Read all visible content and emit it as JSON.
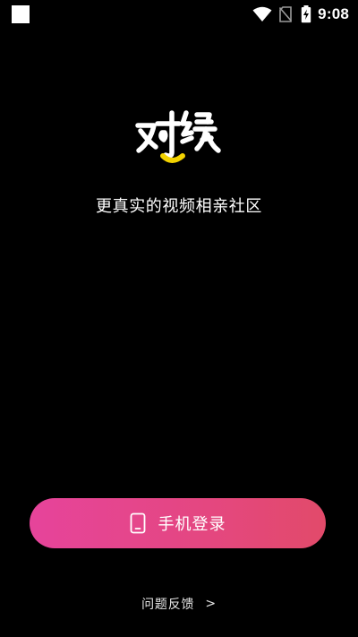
{
  "status_bar": {
    "time": "9:08",
    "icons": [
      "notification-square-icon",
      "wifi-icon",
      "no-sim-icon",
      "battery-charging-icon"
    ]
  },
  "app": {
    "logo_text": "对缘",
    "tagline": "更真实的视频相亲社区",
    "accent_color": "#f2d200"
  },
  "login": {
    "label": "手机登录",
    "icon": "phone-icon",
    "gradient_start": "#e6449b",
    "gradient_end": "#e24a6a"
  },
  "feedback": {
    "label": "问题反馈",
    "chevron": ">"
  }
}
